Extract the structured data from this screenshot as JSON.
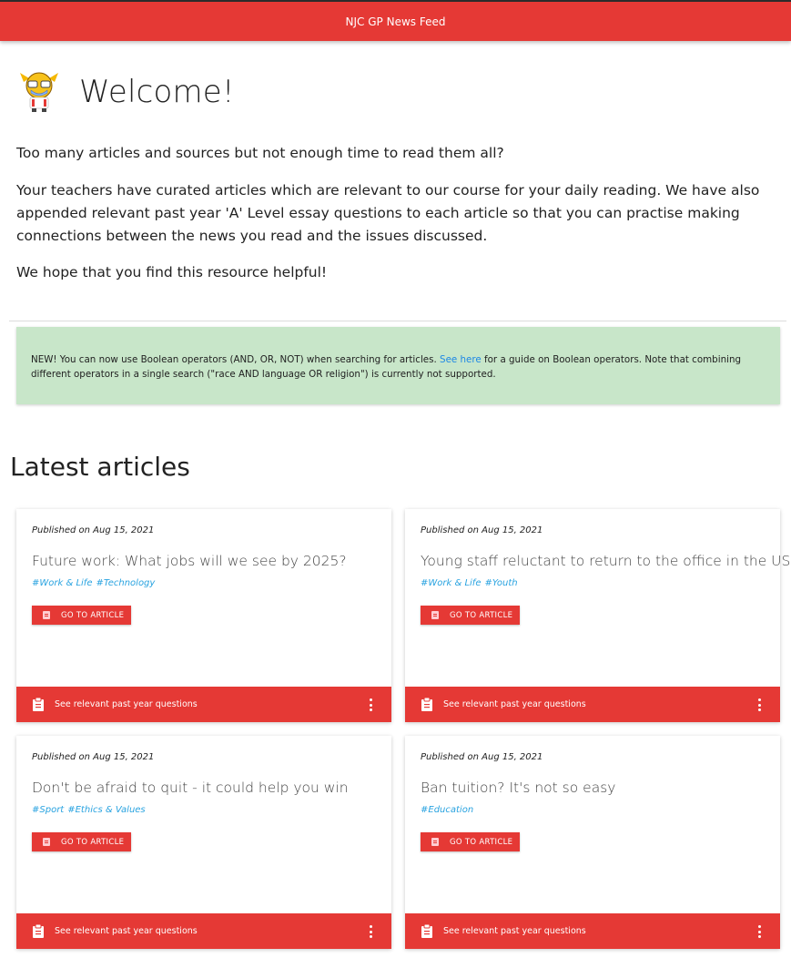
{
  "header": {
    "title": "NJC GP News Feed"
  },
  "welcome": {
    "title": "Welcome!",
    "paragraphs": [
      "Too many articles and sources but not enough time to read them all?",
      "Your teachers have curated articles which are relevant to our course for your daily reading. We have also appended relevant past year 'A' Level essay questions to each article so that you can practise making connections between the news you read and the issues discussed.",
      "We hope that you find this resource helpful!"
    ]
  },
  "notice": {
    "before_link": "NEW! You can now use Boolean operators (AND, OR, NOT) when searching for articles. ",
    "link_text": "See here",
    "after_link": " for a guide on Boolean operators. Note that combining different operators in a single search (\"race AND language OR religion\") is currently not supported."
  },
  "latest": {
    "title": "Latest articles",
    "go_label": "GO TO ARTICLE",
    "footer_label": "See relevant past year questions",
    "articles": [
      {
        "published": "Published on Aug 15, 2021",
        "title": "Future work: What jobs will we see by 2025?",
        "tags": [
          "#Work & Life",
          "#Technology"
        ]
      },
      {
        "published": "Published on Aug 15, 2021",
        "title": "Young staff reluctant to return to the office in the US",
        "tags": [
          "#Work & Life",
          "#Youth"
        ]
      },
      {
        "published": "Published on Aug 15, 2021",
        "title": "Don't be afraid to quit - it could help you win",
        "tags": [
          "#Sport",
          "#Ethics & Values"
        ]
      },
      {
        "published": "Published on Aug 15, 2021",
        "title": "Ban tuition? It's not so easy",
        "tags": [
          "#Education"
        ]
      }
    ]
  },
  "colors": {
    "brand": "#e53935",
    "notice_bg": "#c8e6c9",
    "tag": "#29a3e0",
    "link": "#1e88e5"
  },
  "icons": {
    "mascot": "mascot-logo",
    "go": "document-icon",
    "footer": "clipboard-icon",
    "menu": "more-vert-icon"
  }
}
